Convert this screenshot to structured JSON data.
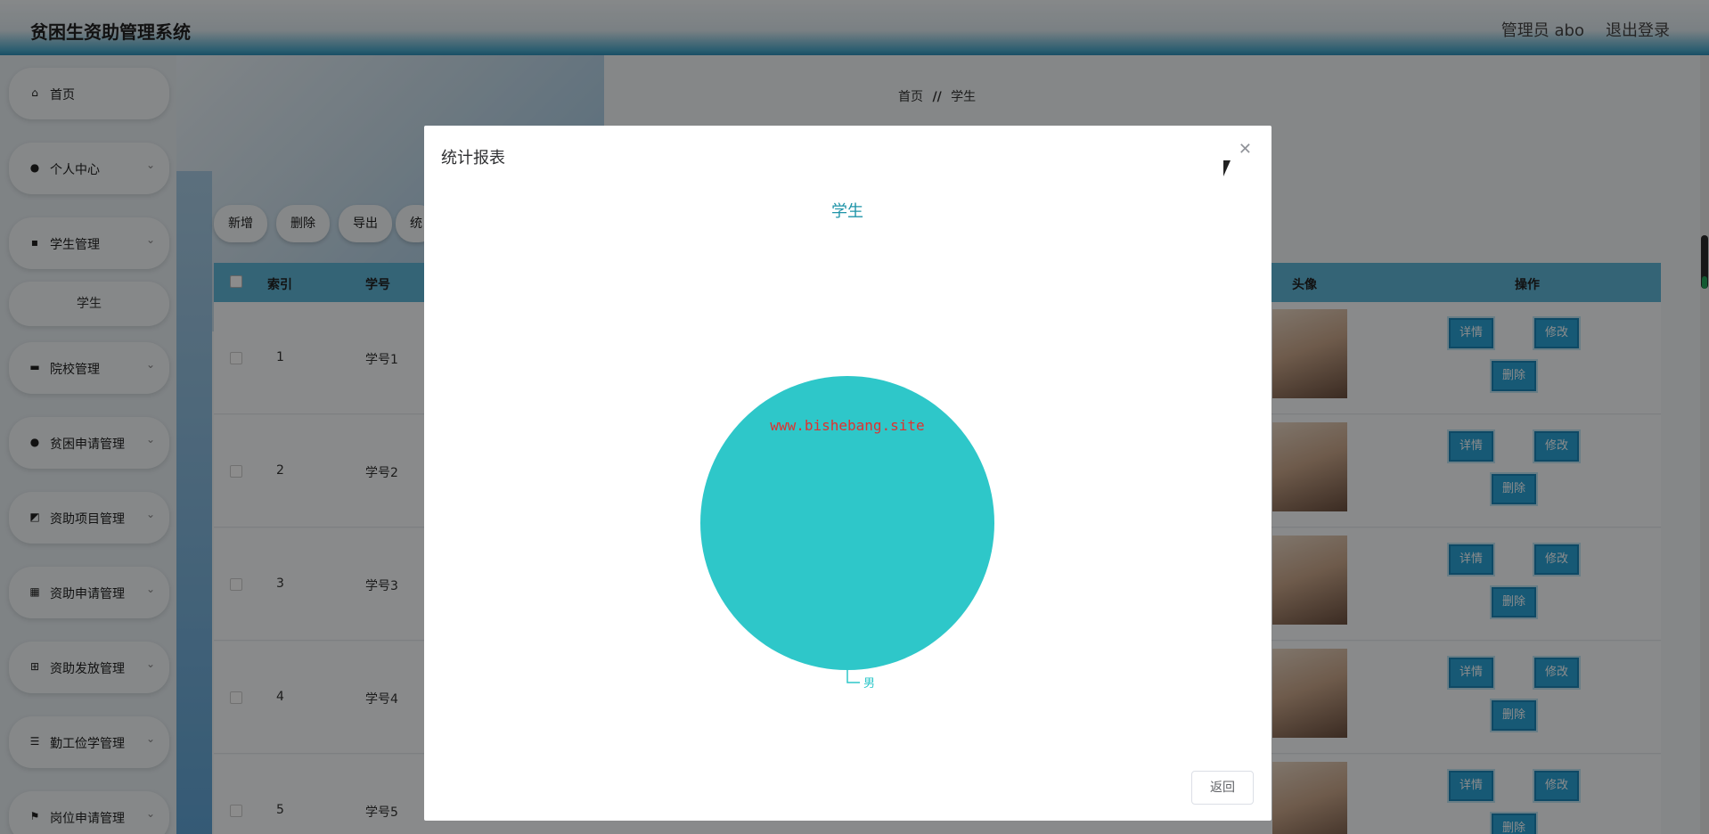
{
  "header": {
    "title": "贫困生资助管理系统",
    "user": "管理员 abo",
    "logout": "退出登录"
  },
  "sidebar": {
    "items": [
      {
        "label": "首页",
        "icon": "home-icon",
        "arrow": false
      },
      {
        "label": "个人中心",
        "icon": "user-icon",
        "arrow": true
      },
      {
        "label": "学生管理",
        "icon": "chat-icon",
        "arrow": true
      },
      {
        "label": "院校管理",
        "icon": "briefcase-icon",
        "arrow": true
      },
      {
        "label": "贫困申请管理",
        "icon": "user-icon",
        "arrow": true
      },
      {
        "label": "资助项目管理",
        "icon": "chart-icon",
        "arrow": true
      },
      {
        "label": "资助申请管理",
        "icon": "grid-icon",
        "arrow": true
      },
      {
        "label": "资助发放管理",
        "icon": "grid-small-icon",
        "arrow": true
      },
      {
        "label": "勤工俭学管理",
        "icon": "list-icon",
        "arrow": true
      },
      {
        "label": "岗位申请管理",
        "icon": "flag-icon",
        "arrow": true
      }
    ],
    "sub_item": "学生"
  },
  "breadcrumb": {
    "home": "首页",
    "sep": "//",
    "current": "学生"
  },
  "toolbar": {
    "add": "新增",
    "delete": "删除",
    "export": "导出",
    "stats": "统"
  },
  "table": {
    "headers": {
      "index": "索引",
      "no": "学号",
      "avatar": "头像",
      "ops": "操作"
    },
    "rows": [
      {
        "index": "1",
        "no": "学号1"
      },
      {
        "index": "2",
        "no": "学号2"
      },
      {
        "index": "3",
        "no": "学号3"
      },
      {
        "index": "4",
        "no": "学号4"
      },
      {
        "index": "5",
        "no": "学号5"
      }
    ],
    "ops": {
      "detail": "详情",
      "edit": "修改",
      "delete": "删除"
    }
  },
  "modal": {
    "title": "统计报表",
    "return": "返回"
  },
  "chart_data": {
    "type": "pie",
    "title": "学生",
    "slices": [
      {
        "label": "男",
        "value": 1
      }
    ],
    "watermark": "www.bishebang.site",
    "colors": {
      "slice": "#2ec7c9",
      "title": "#1f94a8",
      "watermark": "#e0312f"
    }
  }
}
